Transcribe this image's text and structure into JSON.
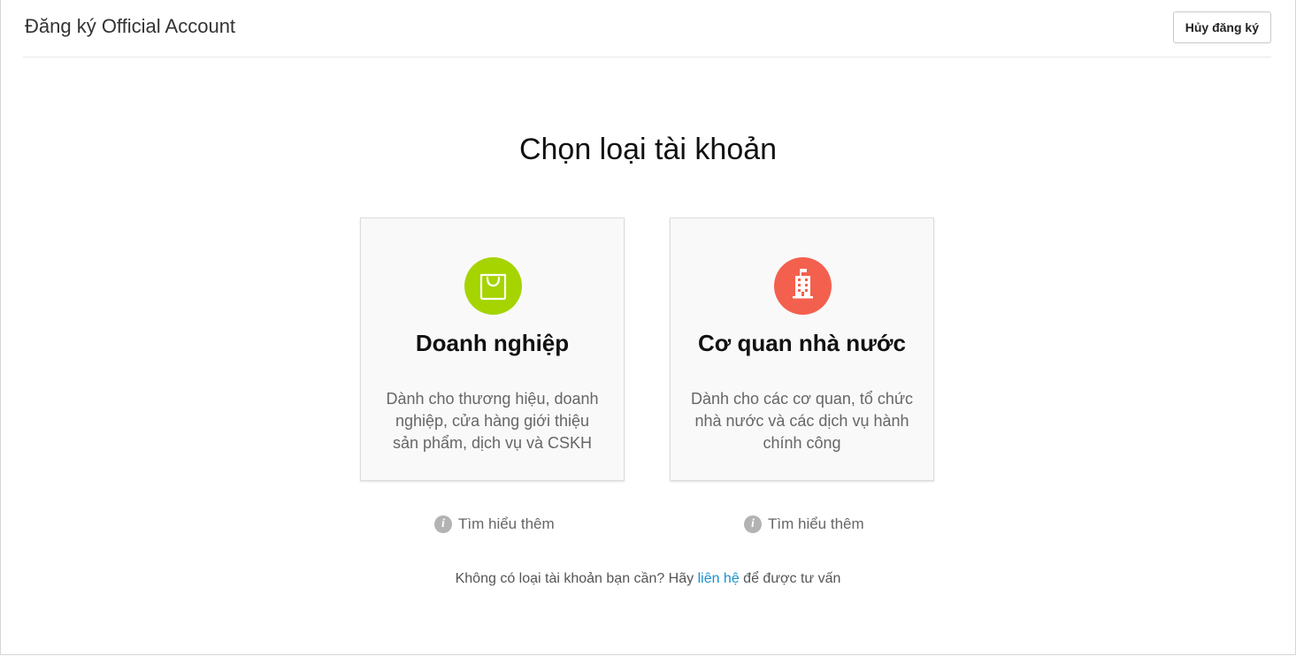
{
  "header": {
    "title": "Đăng ký Official Account",
    "cancel_label": "Hủy đăng ký"
  },
  "main": {
    "heading": "Chọn loại tài khoản",
    "cards": [
      {
        "title": "Doanh nghiệp",
        "description": "Dành cho thương hiệu, doanh nghiệp, cửa hàng giới thiệu sản phẩm, dịch vụ và CSKH",
        "icon": "shopping-bag-icon",
        "icon_color": "#a5d400",
        "learn_more": "Tìm hiểu thêm"
      },
      {
        "title": "Cơ quan nhà nước",
        "description": "Dành cho các cơ quan, tổ chức nhà nước và các dịch vụ hành chính công",
        "icon": "government-building-icon",
        "icon_color": "#f4604e",
        "learn_more": "Tìm hiểu thêm"
      }
    ],
    "footer": {
      "prefix": "Không có loại tài khoản bạn cần? Hãy ",
      "link": "liên hệ",
      "suffix": " để được tư vấn"
    }
  },
  "colors": {
    "link": "#1a8fd1",
    "info_icon": "#b3b3b3"
  }
}
